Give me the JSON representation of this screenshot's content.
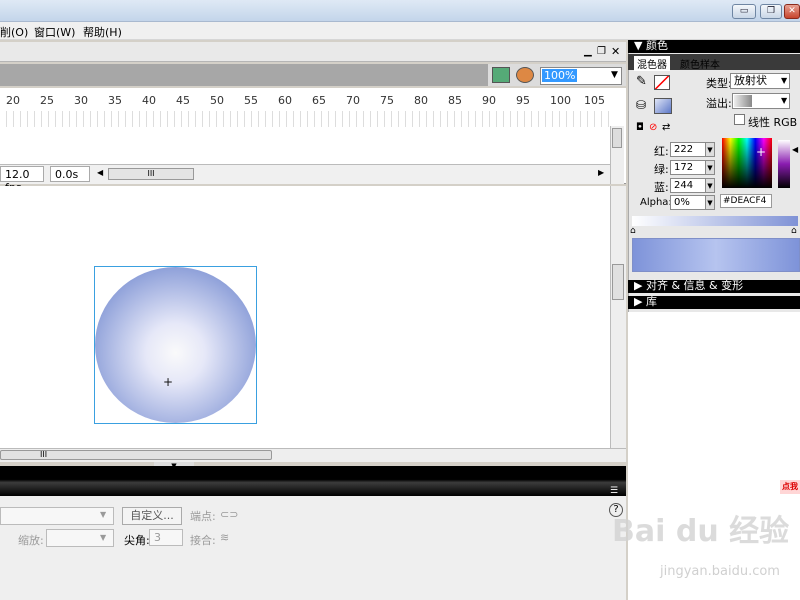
{
  "window": {
    "minimize": "▭",
    "restore": "❐",
    "close": "✕"
  },
  "menu": {
    "items": [
      "削(O)",
      "窗口(W)",
      "帮助(H)"
    ]
  },
  "toolbar": {
    "zoom": "100%"
  },
  "timeline": {
    "ruler": [
      "20",
      "25",
      "30",
      "35",
      "40",
      "45",
      "50",
      "55",
      "60",
      "65",
      "70",
      "75",
      "80",
      "85",
      "90",
      "95",
      "100",
      "105"
    ],
    "fps": "12.0 fps",
    "time": "0.0s",
    "scroll_grip": "III"
  },
  "stage": {
    "fill_center": "#fafafa",
    "fill_edge": "#5d78c8",
    "box_color": "#3aa0e0",
    "scroll_grip": "III"
  },
  "properties": {
    "custom_button": "自定义...",
    "cap_label": "端点:",
    "scale_label": "缩放:",
    "miter_label": "尖角:",
    "miter_value": "3",
    "join_label": "接合:",
    "help": "?"
  },
  "color_panel": {
    "title": "颜色",
    "tab_mixer": "混色器",
    "tab_swatches": "颜色样本",
    "type_label": "类型:",
    "type_value": "放射状",
    "overflow_label": "溢出:",
    "linear_rgb": "线性 RGB",
    "red_label": "红:",
    "red_value": "222",
    "green_label": "绿:",
    "green_value": "172",
    "blue_label": "蓝:",
    "blue_value": "244",
    "alpha_label": "Alpha:",
    "alpha_value": "0%",
    "hex": "#DEACF4"
  },
  "panels": {
    "align": "对齐 & 信息 & 变形",
    "library": "库"
  },
  "watermark": {
    "brand": "Bai du 经验",
    "url": "jingyan.baidu.com",
    "badge": "点我"
  }
}
